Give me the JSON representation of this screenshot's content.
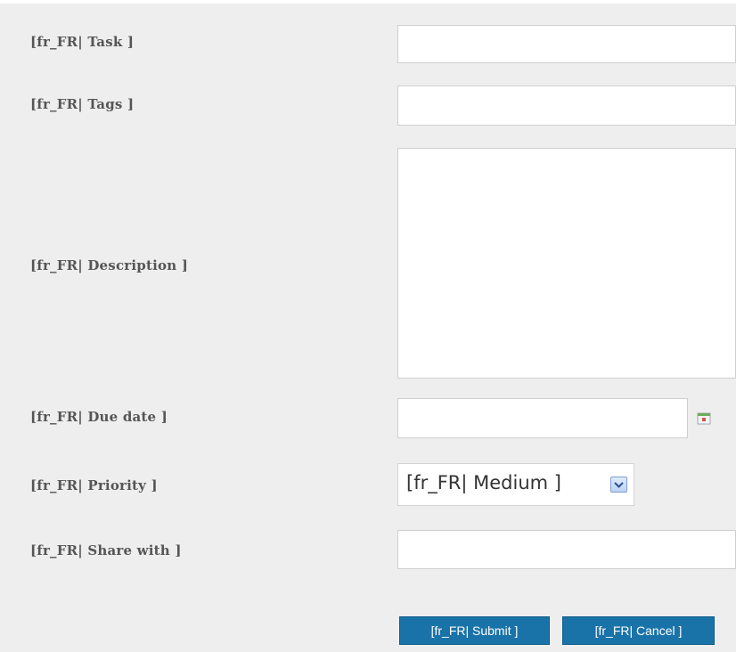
{
  "form": {
    "labels": {
      "task": "[fr_FR| Task ]",
      "tags": "[fr_FR| Tags ]",
      "description": "[fr_FR| Description ]",
      "due_date": "[fr_FR| Due date ]",
      "priority": "[fr_FR| Priority ]",
      "share_with": "[fr_FR| Share with ]"
    },
    "values": {
      "task": "",
      "tags": "",
      "description": "",
      "due_date": "",
      "share_with": ""
    },
    "priority_selected": "[fr_FR| Medium ]",
    "icons": {
      "calendar": "calendar-icon",
      "dropdown": "chevron-down-icon"
    }
  },
  "buttons": {
    "submit": "[fr_FR| Submit ]",
    "cancel": "[fr_FR| Cancel ]"
  },
  "colors": {
    "panel_bg": "#eeeeee",
    "label": "#555555",
    "button_bg": "#1a73a8"
  }
}
